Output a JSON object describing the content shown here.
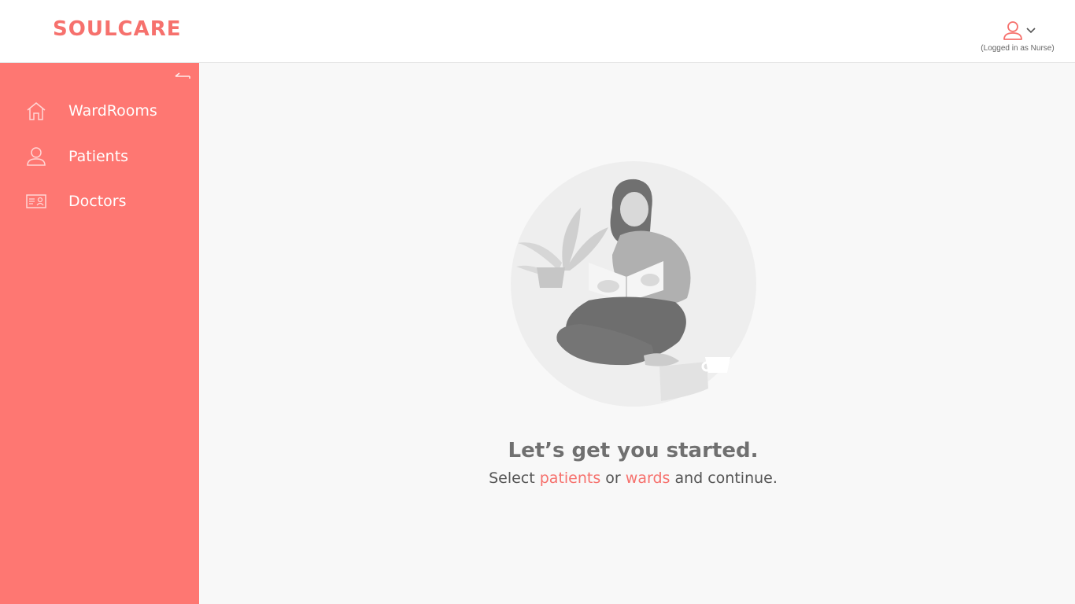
{
  "app": {
    "logo": "SOULCARE"
  },
  "user": {
    "role_text": "(Logged in as Nurse)",
    "icon": "user-icon",
    "menu_icon": "chevron-down-icon"
  },
  "sidebar": {
    "collapse_icon": "arrow-left-icon",
    "items": [
      {
        "label": "WardRooms",
        "icon": "home-icon"
      },
      {
        "label": "Patients",
        "icon": "user-icon"
      },
      {
        "label": "Doctors",
        "icon": "id-card-icon"
      }
    ]
  },
  "main": {
    "headline": "Let’s get you started.",
    "sub_prefix": "Select ",
    "sub_link_patients": "patients",
    "sub_middle": " or ",
    "sub_link_wards": "wards",
    "sub_suffix": " and continue."
  },
  "colors": {
    "accent": "#f6716d",
    "sidebar_bg": "#fe7772",
    "main_bg": "#f8f8f8"
  }
}
